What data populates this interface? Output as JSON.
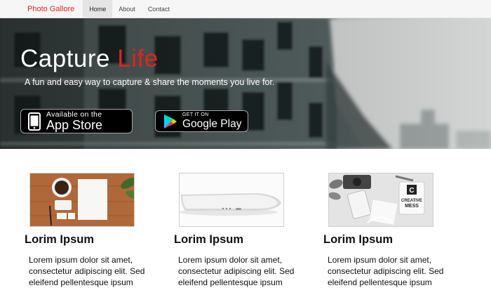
{
  "navbar": {
    "brand": "Photo Gallore",
    "items": [
      {
        "label": "Home",
        "active": true
      },
      {
        "label": "About",
        "active": false
      },
      {
        "label": "Contact",
        "active": false
      }
    ]
  },
  "hero": {
    "title_main": "Capture ",
    "title_accent": "Life",
    "subtitle": "A fun and easy way to capture & share the moments you live for.",
    "app_store": {
      "small": "Available on the",
      "big": "App Store"
    },
    "google_play": {
      "small": "GET IT ON",
      "big": "Google Play"
    }
  },
  "cards": [
    {
      "title": "Lorim Ipsum",
      "text": "Lorem ipsum dolor sit amet, consectetur adipiscing elit. Sed eleifend pellentesque ipsum"
    },
    {
      "title": "Lorim Ipsum",
      "text": "Lorem ipsum dolor sit amet, consectetur adipiscing elit. Sed eleifend pellentesque ipsum"
    },
    {
      "title": "Lorim Ipsum",
      "text": "Lorem ipsum dolor sit amet, consectetur adipiscing elit. Sed eleifend pellentesque ipsum"
    }
  ],
  "card_images": {
    "mug_note": "CREATIVE MESS",
    "mug_letter": "C"
  },
  "colors": {
    "brand": "#e0261b",
    "accent": "#e0241b",
    "nav_active_bg": "#e5e5e5"
  }
}
